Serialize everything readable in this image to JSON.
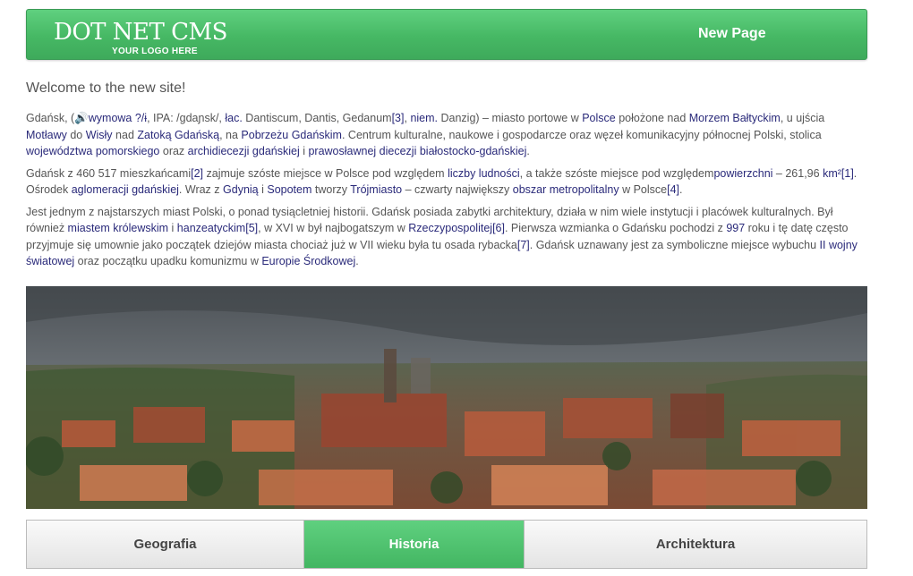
{
  "header": {
    "logo_title": "DOT NET CMS",
    "logo_subtitle": "YOUR LOGO HERE",
    "nav_label": "New Page"
  },
  "welcome": "Welcome to the new site!",
  "article": {
    "p1": [
      {
        "t": "Gdańsk, ("
      },
      {
        "t": "🔊",
        "icon": "speaker-icon"
      },
      {
        "t": "wymowa ?/ɨ",
        "link": true
      },
      {
        "t": ", IPA: /gdaɲsk/, "
      },
      {
        "t": "łac.",
        "link": true
      },
      {
        "t": " Dantiscum, Dantis, Gedanum"
      },
      {
        "t": "[3]",
        "link": true
      },
      {
        "t": ", "
      },
      {
        "t": "niem.",
        "link": true
      },
      {
        "t": " Danzig) – miasto portowe w "
      },
      {
        "t": "Polsce",
        "link": true
      },
      {
        "t": " położone nad "
      },
      {
        "t": "Morzem Bałtyckim",
        "link": true
      },
      {
        "t": ", u ujścia "
      },
      {
        "t": "Motławy",
        "link": true
      },
      {
        "t": " do "
      },
      {
        "t": "Wisły",
        "link": true
      },
      {
        "t": " nad "
      },
      {
        "t": "Zatoką Gdańską",
        "link": true
      },
      {
        "t": ", na "
      },
      {
        "t": "Pobrzeżu Gdańskim",
        "link": true
      },
      {
        "t": ". Centrum kulturalne, naukowe i gospodarcze oraz węzeł komunikacyjny północnej Polski, stolica "
      },
      {
        "t": "województwa pomorskiego",
        "link": true
      },
      {
        "t": " oraz "
      },
      {
        "t": "archidiecezji gdańskiej",
        "link": true
      },
      {
        "t": " i "
      },
      {
        "t": "prawosławnej diecezji białostocko-gdańskiej",
        "link": true
      },
      {
        "t": "."
      }
    ],
    "p2": [
      {
        "t": "Gdańsk z 460 517 mieszkańcami"
      },
      {
        "t": "[2]",
        "link": true
      },
      {
        "t": " zajmuje szóste miejsce w Polsce pod względem "
      },
      {
        "t": "liczby ludności",
        "link": true
      },
      {
        "t": ", a także szóste miejsce pod względem"
      },
      {
        "t": "powierzchni",
        "link": true
      },
      {
        "t": " – 261,96 "
      },
      {
        "t": "km²",
        "link": true
      },
      {
        "t": "[1]",
        "link": true
      },
      {
        "t": ". Ośrodek "
      },
      {
        "t": "aglomeracji gdańskiej",
        "link": true
      },
      {
        "t": ". Wraz z "
      },
      {
        "t": "Gdynią",
        "link": true
      },
      {
        "t": " i "
      },
      {
        "t": "Sopotem",
        "link": true
      },
      {
        "t": " tworzy "
      },
      {
        "t": "Trójmiasto",
        "link": true
      },
      {
        "t": " – czwarty największy "
      },
      {
        "t": "obszar metropolitalny",
        "link": true
      },
      {
        "t": " w Polsce"
      },
      {
        "t": "[4]",
        "link": true
      },
      {
        "t": "."
      }
    ],
    "p3": [
      {
        "t": "Jest jednym z najstarszych miast Polski, o ponad tysiącletniej historii. Gdańsk posiada zabytki architektury, działa w nim wiele instytucji i placówek kulturalnych. Był również "
      },
      {
        "t": "miastem królewskim",
        "link": true
      },
      {
        "t": " i "
      },
      {
        "t": "hanzeatyckim",
        "link": true
      },
      {
        "t": "[5]",
        "link": true
      },
      {
        "t": ", w XVI w był najbogatszym w "
      },
      {
        "t": "Rzeczypospolitej",
        "link": true
      },
      {
        "t": "[6]",
        "link": true
      },
      {
        "t": ". Pierwsza wzmianka o Gdańsku pochodzi z "
      },
      {
        "t": "997",
        "link": true
      },
      {
        "t": " roku i tę datę często przyjmuje się umownie jako początek dziejów miasta chociaż już w VII wieku była tu osada rybacka"
      },
      {
        "t": "[7]",
        "link": true
      },
      {
        "t": ". Gdańsk uznawany jest za symboliczne miejsce wybuchu "
      },
      {
        "t": "II wojny światowej",
        "link": true
      },
      {
        "t": " oraz początku upadku komunizmu w "
      },
      {
        "t": "Europie Środkowej",
        "link": true
      },
      {
        "t": "."
      }
    ]
  },
  "tabs": [
    {
      "label": "Geografia",
      "active": false
    },
    {
      "label": "Historia",
      "active": true
    },
    {
      "label": "Architektura",
      "active": false
    }
  ],
  "colors": {
    "accent_green": "#4cc26b",
    "link": "#2a2a7a",
    "text": "#555555"
  }
}
